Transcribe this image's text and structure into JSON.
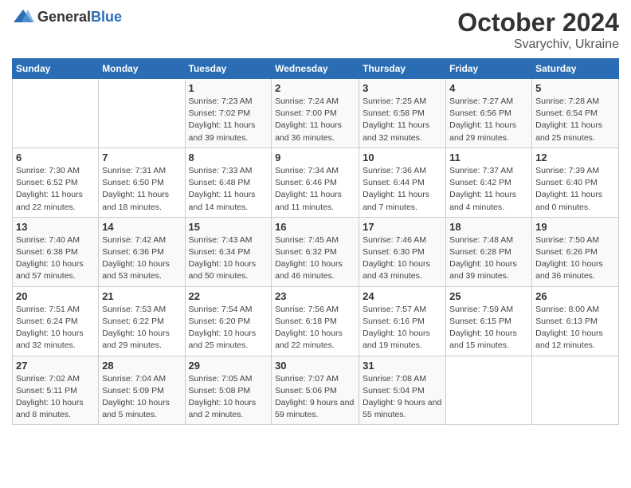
{
  "logo": {
    "text_general": "General",
    "text_blue": "Blue"
  },
  "header": {
    "month": "October 2024",
    "location": "Svarychiv, Ukraine"
  },
  "days_of_week": [
    "Sunday",
    "Monday",
    "Tuesday",
    "Wednesday",
    "Thursday",
    "Friday",
    "Saturday"
  ],
  "weeks": [
    [
      {
        "day": "",
        "sunrise": "",
        "sunset": "",
        "daylight": ""
      },
      {
        "day": "",
        "sunrise": "",
        "sunset": "",
        "daylight": ""
      },
      {
        "day": "1",
        "sunrise": "Sunrise: 7:23 AM",
        "sunset": "Sunset: 7:02 PM",
        "daylight": "Daylight: 11 hours and 39 minutes."
      },
      {
        "day": "2",
        "sunrise": "Sunrise: 7:24 AM",
        "sunset": "Sunset: 7:00 PM",
        "daylight": "Daylight: 11 hours and 36 minutes."
      },
      {
        "day": "3",
        "sunrise": "Sunrise: 7:25 AM",
        "sunset": "Sunset: 6:58 PM",
        "daylight": "Daylight: 11 hours and 32 minutes."
      },
      {
        "day": "4",
        "sunrise": "Sunrise: 7:27 AM",
        "sunset": "Sunset: 6:56 PM",
        "daylight": "Daylight: 11 hours and 29 minutes."
      },
      {
        "day": "5",
        "sunrise": "Sunrise: 7:28 AM",
        "sunset": "Sunset: 6:54 PM",
        "daylight": "Daylight: 11 hours and 25 minutes."
      }
    ],
    [
      {
        "day": "6",
        "sunrise": "Sunrise: 7:30 AM",
        "sunset": "Sunset: 6:52 PM",
        "daylight": "Daylight: 11 hours and 22 minutes."
      },
      {
        "day": "7",
        "sunrise": "Sunrise: 7:31 AM",
        "sunset": "Sunset: 6:50 PM",
        "daylight": "Daylight: 11 hours and 18 minutes."
      },
      {
        "day": "8",
        "sunrise": "Sunrise: 7:33 AM",
        "sunset": "Sunset: 6:48 PM",
        "daylight": "Daylight: 11 hours and 14 minutes."
      },
      {
        "day": "9",
        "sunrise": "Sunrise: 7:34 AM",
        "sunset": "Sunset: 6:46 PM",
        "daylight": "Daylight: 11 hours and 11 minutes."
      },
      {
        "day": "10",
        "sunrise": "Sunrise: 7:36 AM",
        "sunset": "Sunset: 6:44 PM",
        "daylight": "Daylight: 11 hours and 7 minutes."
      },
      {
        "day": "11",
        "sunrise": "Sunrise: 7:37 AM",
        "sunset": "Sunset: 6:42 PM",
        "daylight": "Daylight: 11 hours and 4 minutes."
      },
      {
        "day": "12",
        "sunrise": "Sunrise: 7:39 AM",
        "sunset": "Sunset: 6:40 PM",
        "daylight": "Daylight: 11 hours and 0 minutes."
      }
    ],
    [
      {
        "day": "13",
        "sunrise": "Sunrise: 7:40 AM",
        "sunset": "Sunset: 6:38 PM",
        "daylight": "Daylight: 10 hours and 57 minutes."
      },
      {
        "day": "14",
        "sunrise": "Sunrise: 7:42 AM",
        "sunset": "Sunset: 6:36 PM",
        "daylight": "Daylight: 10 hours and 53 minutes."
      },
      {
        "day": "15",
        "sunrise": "Sunrise: 7:43 AM",
        "sunset": "Sunset: 6:34 PM",
        "daylight": "Daylight: 10 hours and 50 minutes."
      },
      {
        "day": "16",
        "sunrise": "Sunrise: 7:45 AM",
        "sunset": "Sunset: 6:32 PM",
        "daylight": "Daylight: 10 hours and 46 minutes."
      },
      {
        "day": "17",
        "sunrise": "Sunrise: 7:46 AM",
        "sunset": "Sunset: 6:30 PM",
        "daylight": "Daylight: 10 hours and 43 minutes."
      },
      {
        "day": "18",
        "sunrise": "Sunrise: 7:48 AM",
        "sunset": "Sunset: 6:28 PM",
        "daylight": "Daylight: 10 hours and 39 minutes."
      },
      {
        "day": "19",
        "sunrise": "Sunrise: 7:50 AM",
        "sunset": "Sunset: 6:26 PM",
        "daylight": "Daylight: 10 hours and 36 minutes."
      }
    ],
    [
      {
        "day": "20",
        "sunrise": "Sunrise: 7:51 AM",
        "sunset": "Sunset: 6:24 PM",
        "daylight": "Daylight: 10 hours and 32 minutes."
      },
      {
        "day": "21",
        "sunrise": "Sunrise: 7:53 AM",
        "sunset": "Sunset: 6:22 PM",
        "daylight": "Daylight: 10 hours and 29 minutes."
      },
      {
        "day": "22",
        "sunrise": "Sunrise: 7:54 AM",
        "sunset": "Sunset: 6:20 PM",
        "daylight": "Daylight: 10 hours and 25 minutes."
      },
      {
        "day": "23",
        "sunrise": "Sunrise: 7:56 AM",
        "sunset": "Sunset: 6:18 PM",
        "daylight": "Daylight: 10 hours and 22 minutes."
      },
      {
        "day": "24",
        "sunrise": "Sunrise: 7:57 AM",
        "sunset": "Sunset: 6:16 PM",
        "daylight": "Daylight: 10 hours and 19 minutes."
      },
      {
        "day": "25",
        "sunrise": "Sunrise: 7:59 AM",
        "sunset": "Sunset: 6:15 PM",
        "daylight": "Daylight: 10 hours and 15 minutes."
      },
      {
        "day": "26",
        "sunrise": "Sunrise: 8:00 AM",
        "sunset": "Sunset: 6:13 PM",
        "daylight": "Daylight: 10 hours and 12 minutes."
      }
    ],
    [
      {
        "day": "27",
        "sunrise": "Sunrise: 7:02 AM",
        "sunset": "Sunset: 5:11 PM",
        "daylight": "Daylight: 10 hours and 8 minutes."
      },
      {
        "day": "28",
        "sunrise": "Sunrise: 7:04 AM",
        "sunset": "Sunset: 5:09 PM",
        "daylight": "Daylight: 10 hours and 5 minutes."
      },
      {
        "day": "29",
        "sunrise": "Sunrise: 7:05 AM",
        "sunset": "Sunset: 5:08 PM",
        "daylight": "Daylight: 10 hours and 2 minutes."
      },
      {
        "day": "30",
        "sunrise": "Sunrise: 7:07 AM",
        "sunset": "Sunset: 5:06 PM",
        "daylight": "Daylight: 9 hours and 59 minutes."
      },
      {
        "day": "31",
        "sunrise": "Sunrise: 7:08 AM",
        "sunset": "Sunset: 5:04 PM",
        "daylight": "Daylight: 9 hours and 55 minutes."
      },
      {
        "day": "",
        "sunrise": "",
        "sunset": "",
        "daylight": ""
      },
      {
        "day": "",
        "sunrise": "",
        "sunset": "",
        "daylight": ""
      }
    ]
  ]
}
